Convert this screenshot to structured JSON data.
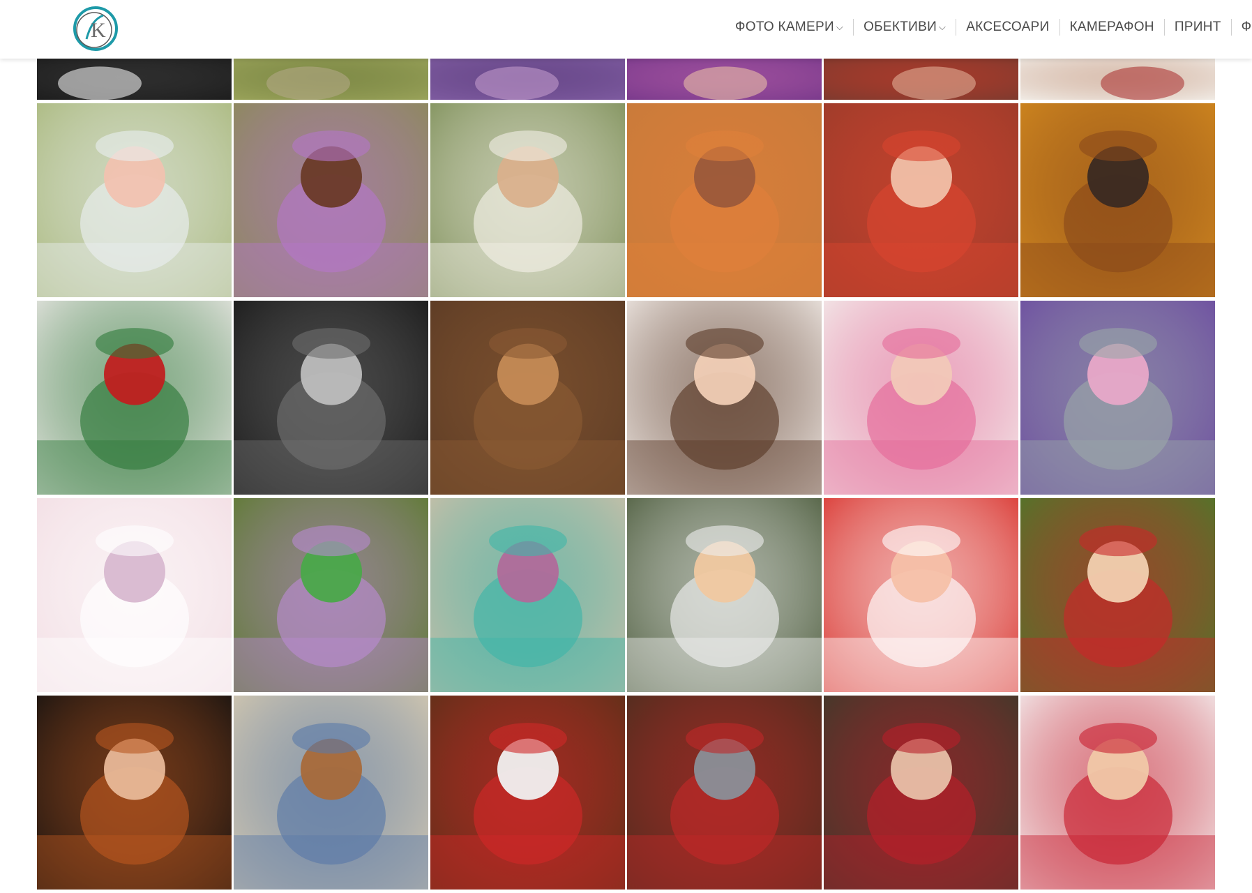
{
  "header": {
    "logo": {
      "name": "site-logo",
      "letter": "K"
    },
    "nav": [
      {
        "label": "ФОТО КАМЕРИ",
        "dropdown": true
      },
      {
        "label": "ОБЕКТИВИ",
        "dropdown": true
      },
      {
        "label": "АКСЕСОАРИ",
        "dropdown": false
      },
      {
        "label": "КАМЕРАФОН",
        "dropdown": false
      },
      {
        "label": "ПРИНТ",
        "dropdown": false
      },
      {
        "label": "ФО",
        "dropdown": false
      }
    ]
  },
  "gallery": {
    "rows": [
      [
        {
          "name": "photo-dark-bw",
          "bg": "#1d1d1d",
          "accent": "#3a3a3a",
          "fig": "#ffffff"
        },
        {
          "name": "photo-orchard",
          "bg": "#9aa35a",
          "accent": "#6d7a3a",
          "fig": "#b7a98a"
        },
        {
          "name": "photo-lavender-field",
          "bg": "#7e5ba0",
          "accent": "#5c3d7d",
          "fig": "#c9a0d0"
        },
        {
          "name": "photo-purple-girl",
          "bg": "#7a3a8c",
          "accent": "#b05aa5",
          "fig": "#f0c8a8"
        },
        {
          "name": "photo-red-dress",
          "bg": "#7d3a2e",
          "accent": "#c23a2a",
          "fig": "#e8b8a0"
        },
        {
          "name": "photo-white-knit",
          "bg": "#f1ece6",
          "accent": "#c9a08a",
          "fig": "#a82a2a"
        }
      ],
      [
        {
          "name": "photo-girl-blossom-veil",
          "bg": "#a8b77a",
          "accent": "#e9eef0",
          "fig": "#f1c2b0"
        },
        {
          "name": "photo-girl-purple-dress",
          "bg": "#8a8a55",
          "accent": "#b477c8",
          "fig": "#6a3a28"
        },
        {
          "name": "photo-boy-white-cap",
          "bg": "#7b8d55",
          "accent": "#f2efe6",
          "fig": "#d9b08c"
        },
        {
          "name": "photo-girl-autumn-hat-bunny",
          "bg": "#c77a3a",
          "accent": "#e0803a",
          "fig": "#9b5a3a"
        },
        {
          "name": "photo-girl-red-cowboy-hat",
          "bg": "#9a3b2a",
          "accent": "#d9452f",
          "fig": "#f0c0a8"
        },
        {
          "name": "photo-kids-pony-autumn",
          "bg": "#d2891f",
          "accent": "#8b4a1a",
          "fig": "#3a2a22"
        }
      ],
      [
        {
          "name": "photo-girl-snow-christmas",
          "bg": "#ece8e6",
          "accent": "#2f7a3a",
          "fig": "#c02020"
        },
        {
          "name": "photo-father-newborn-bw",
          "bg": "#161616",
          "accent": "#6e6e6e",
          "fig": "#bdbdbd"
        },
        {
          "name": "photo-newborn-teddy-bears",
          "bg": "#5a3a24",
          "accent": "#8b5a33",
          "fig": "#c48a55"
        },
        {
          "name": "photo-girl-portrait-smile",
          "bg": "#f4eeea",
          "accent": "#5a3a28",
          "fig": "#f0cdb5"
        },
        {
          "name": "photo-newborn-flower-hoop",
          "bg": "#f3efec",
          "accent": "#e56a9a",
          "fig": "#f2c8b8"
        },
        {
          "name": "photo-newborn-purple-fur",
          "bg": "#6b4aa0",
          "accent": "#9aa6a8",
          "fig": "#e8a8c8"
        }
      ],
      [
        {
          "name": "photo-newborn-pink-clock",
          "bg": "#f2dde3",
          "accent": "#ffffff",
          "fig": "#d8b8d0"
        },
        {
          "name": "photo-newborn-wheelbarrow",
          "bg": "#5a7a2a",
          "accent": "#b88ad0",
          "fig": "#4aa84a"
        },
        {
          "name": "photo-newborn-teal-bed",
          "bg": "#cdbfa8",
          "accent": "#3fb5a8",
          "fig": "#b06a9a"
        },
        {
          "name": "photo-baby-bathtub",
          "bg": "#4a5a3a",
          "accent": "#eeeeee",
          "fig": "#f0c8a0"
        },
        {
          "name": "photo-newborn-red-polka",
          "bg": "#d8302a",
          "accent": "#ffffff",
          "fig": "#f5c0a8"
        },
        {
          "name": "photo-baby-strawberry-hat",
          "bg": "#4a7a2a",
          "accent": "#c8282a",
          "fig": "#f2d0b0"
        }
      ],
      [
        {
          "name": "photo-newborn-pumpkin",
          "bg": "#101010",
          "accent": "#b8561f",
          "fig": "#e8b898"
        },
        {
          "name": "photo-twins-bed-teddy",
          "bg": "#d8cbb0",
          "accent": "#5a7aa8",
          "fig": "#a86a3a"
        },
        {
          "name": "photo-newborn-christmas-hat",
          "bg": "#5a3018",
          "accent": "#d02828",
          "fig": "#f0f0f0"
        },
        {
          "name": "photo-boy-christmas-train",
          "bg": "#4a2e1e",
          "accent": "#c02828",
          "fig": "#8a8f98"
        },
        {
          "name": "photo-kids-christmas-plaid",
          "bg": "#3a3a2a",
          "accent": "#b81e2a",
          "fig": "#e8c0a8"
        },
        {
          "name": "photo-family-snow-santa",
          "bg": "#f4f2f2",
          "accent": "#c82030",
          "fig": "#f0c8a8"
        }
      ]
    ]
  }
}
